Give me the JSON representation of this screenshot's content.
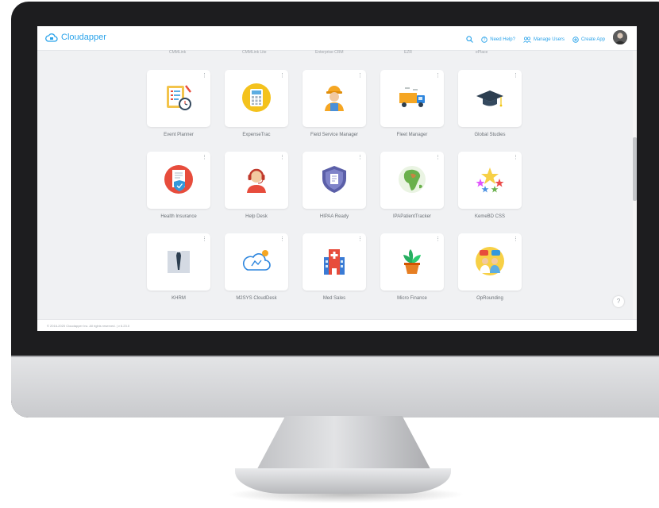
{
  "app": {
    "name": "Cloudapper"
  },
  "nav": {
    "need_help": "Need Help?",
    "manage_users": "Manage Users",
    "create_app": "Create App"
  },
  "ghost_labels": [
    "CMMLink",
    "CMMLink Lite",
    "Enterprise CRM",
    "EZR",
    "ePlace"
  ],
  "apps": [
    {
      "label": "Event Planner",
      "icon": "clipboard-clock-icon"
    },
    {
      "label": "ExpenseTrac",
      "icon": "calculator-icon"
    },
    {
      "label": "Field Service Manager",
      "icon": "worker-icon"
    },
    {
      "label": "Fleet Manager",
      "icon": "truck-icon"
    },
    {
      "label": "Global Studies",
      "icon": "graduation-cap-icon"
    },
    {
      "label": "Health Insurance",
      "icon": "insurance-document-icon"
    },
    {
      "label": "Help Desk",
      "icon": "headset-agent-icon"
    },
    {
      "label": "HIPAA Ready",
      "icon": "shield-document-icon"
    },
    {
      "label": "IPAPatientTracker",
      "icon": "globe-africa-icon"
    },
    {
      "label": "KemeBD CSS",
      "icon": "stars-icon"
    },
    {
      "label": "KHRM",
      "icon": "suit-tie-icon"
    },
    {
      "label": "M2SYS CloudDesk",
      "icon": "cloud-desk-icon"
    },
    {
      "label": "Med Sales",
      "icon": "hospital-icon"
    },
    {
      "label": "Micro Finance",
      "icon": "plant-pot-icon"
    },
    {
      "label": "OpRounding",
      "icon": "doctors-icon"
    }
  ],
  "footer": {
    "text": "© 2016-2020 Cloudapper Inc. All rights reserved. | v 6.23.0"
  },
  "colors": {
    "accent": "#2aa3ea",
    "bezel": "#1d1d1f",
    "screen_bg": "#f0f1f3"
  }
}
